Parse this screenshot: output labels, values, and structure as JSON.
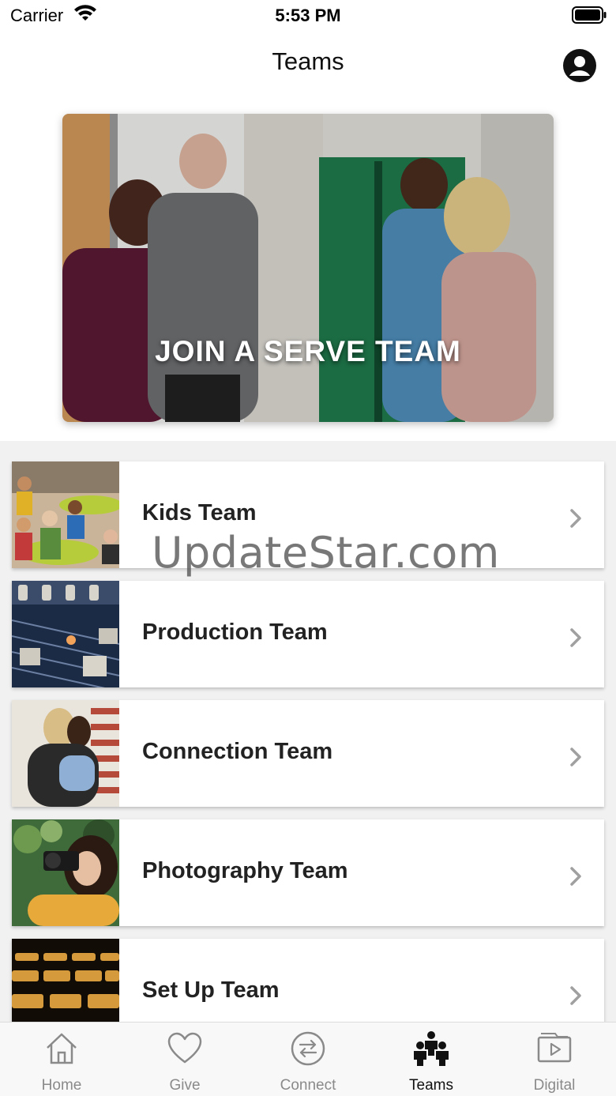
{
  "status_bar": {
    "carrier": "Carrier",
    "time": "5:53 PM"
  },
  "nav": {
    "title": "Teams"
  },
  "banner": {
    "text": "JOIN A SERVE TEAM"
  },
  "teams": [
    {
      "label": "Kids Team"
    },
    {
      "label": "Production Team"
    },
    {
      "label": "Connection Team"
    },
    {
      "label": "Photography Team"
    },
    {
      "label": "Set Up Team"
    }
  ],
  "watermark": "UpdateStar.com",
  "tabs": [
    {
      "label": "Home",
      "icon": "home-icon"
    },
    {
      "label": "Give",
      "icon": "heart-icon"
    },
    {
      "label": "Connect",
      "icon": "connect-arrows-icon"
    },
    {
      "label": "Teams",
      "icon": "people-icon",
      "active": true
    },
    {
      "label": "Digital",
      "icon": "digital-play-icon"
    }
  ],
  "colors": {
    "active_tab": "#111111",
    "inactive_tab": "#8a8a8a",
    "list_background": "#f1f1f1"
  }
}
